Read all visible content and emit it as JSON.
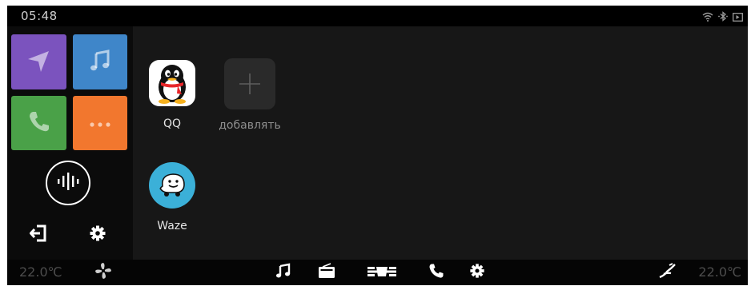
{
  "status": {
    "time": "05:48"
  },
  "sidebar": {
    "tiles": [
      {
        "name": "navigation",
        "icon": "navigation-arrow-icon",
        "color": "#7b53be"
      },
      {
        "name": "music",
        "icon": "music-note-icon",
        "color": "#3f86c9"
      },
      {
        "name": "phone",
        "icon": "phone-icon",
        "color": "#4aa148"
      },
      {
        "name": "more",
        "icon": "more-dots-icon",
        "color": "#f2772e"
      }
    ],
    "voice_icon": "voice-waveform-icon",
    "exit_icon": "exit-icon",
    "settings_icon": "gear-icon"
  },
  "apps": [
    {
      "label": "QQ",
      "icon": "qq-penguin-icon"
    },
    {
      "label": "добавлять",
      "icon": "add-plus-icon"
    },
    {
      "label": "Waze",
      "icon": "waze-icon"
    }
  ],
  "bottom_bar": {
    "temp_left": "22.0℃",
    "temp_right": "22.0℃",
    "icons": [
      "fan-icon",
      "music-note-icon",
      "radio-icon",
      "car-grille-icon",
      "phone-icon",
      "gear-icon",
      "seat-heat-icon"
    ]
  }
}
